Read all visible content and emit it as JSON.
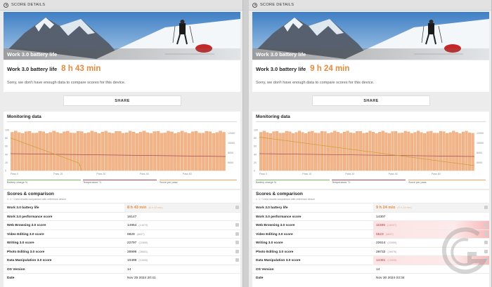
{
  "left": {
    "header": "SCORE DETAILS",
    "hero_title": "Work 3.0 battery life",
    "hero_sub": "",
    "summary_label": "Work 3.0 battery life",
    "summary_value": "8 h 43 min",
    "note": "Sorry, we don't have enough data to compare scores for this device.",
    "share": "SHARE",
    "monitoring_title": "Monitoring data",
    "legend": [
      "Battery charge %",
      "Temperature °C",
      "Score per pass"
    ],
    "scores_title": "Scores & comparison",
    "scores_sub": "1. 1 ~1 test results comparison with reference device",
    "rows": [
      {
        "k": "Work 3.0 battery life",
        "v": "8 h 43 min",
        "ref": "(8 h 43 min)"
      },
      {
        "k": "Work 3.0 performance score",
        "v": "16147",
        "ref": ""
      },
      {
        "k": "Web Browsing 3.0 score",
        "v": "14964",
        "ref": "(14679)"
      },
      {
        "k": "Video Editing 3.0 score",
        "v": "6829",
        "ref": "(6837)"
      },
      {
        "k": "Writing 3.0 score",
        "v": "22797",
        "ref": "(22659)"
      },
      {
        "k": "Photo Editing 3.0 score",
        "v": "28999",
        "ref": "(28651)"
      },
      {
        "k": "Data Manipulation 3.0 score",
        "v": "10499",
        "ref": "(10599)"
      },
      {
        "k": "OS Version",
        "v": "14",
        "ref": ""
      },
      {
        "k": "Date",
        "v": "Nov 25 2024 20:41",
        "ref": ""
      }
    ]
  },
  "right": {
    "header": "SCORE DETAILS",
    "hero_title": "Work 3.0 battery life",
    "hero_sub": "",
    "summary_label": "Work 3.0 battery life",
    "summary_value": "9 h 24 min",
    "note": "Sorry, we don't have enough data to compare scores for this device.",
    "share": "SHARE",
    "monitoring_title": "Monitoring data",
    "legend": [
      "Battery charge %",
      "Temperature °C",
      "Score per pass"
    ],
    "scores_title": "Scores & comparison",
    "scores_sub": "1. 1 ~1 test results comparison with reference device",
    "rows": [
      {
        "k": "Work 3.0 battery life",
        "v": "9 h 24 min",
        "ref": "(9 h 24 min)"
      },
      {
        "k": "Work 3.0 performance score",
        "v": "14307",
        "ref": ""
      },
      {
        "k": "Web Browsing 3.0 score",
        "v": "11595",
        "ref": "(14697)"
      },
      {
        "k": "Video Editing 3.0 score",
        "v": "5523",
        "ref": "(6837)"
      },
      {
        "k": "Writing 3.0 score",
        "v": "22614",
        "ref": "(22659)"
      },
      {
        "k": "Photo Editing 3.0 score",
        "v": "28732",
        "ref": "(28976)"
      },
      {
        "k": "Data Manipulation 3.0 score",
        "v": "14481",
        "ref": "(10505)"
      },
      {
        "k": "OS Version",
        "v": "14",
        "ref": ""
      },
      {
        "k": "Date",
        "v": "Nov 30 2024 03:34",
        "ref": ""
      }
    ]
  },
  "chart_data": [
    {
      "type": "bar",
      "bars": 62,
      "y_left_ticks": [
        "100",
        "80",
        "60",
        "40",
        "20",
        "0"
      ],
      "y_right_ticks": [
        "12000",
        "10000",
        "8000",
        "6000"
      ],
      "x_ticks": [
        "Pass 0",
        "Pass 15",
        "Pass 30",
        "Pass 45",
        "Pass 60"
      ],
      "battery_start": 80,
      "battery_end": 18,
      "battery_cutoff_fraction": 0.32
    },
    {
      "type": "bar",
      "bars": 67,
      "y_left_ticks": [
        "100",
        "80",
        "60",
        "40",
        "20",
        "0"
      ],
      "y_right_ticks": [
        "12000",
        "10000",
        "8000",
        "6000"
      ],
      "x_ticks": [
        "Pass 0",
        "Pass 15",
        "Pass 30",
        "Pass 45",
        "Pass 60"
      ],
      "battery_start": 82,
      "battery_end": 12
    }
  ]
}
